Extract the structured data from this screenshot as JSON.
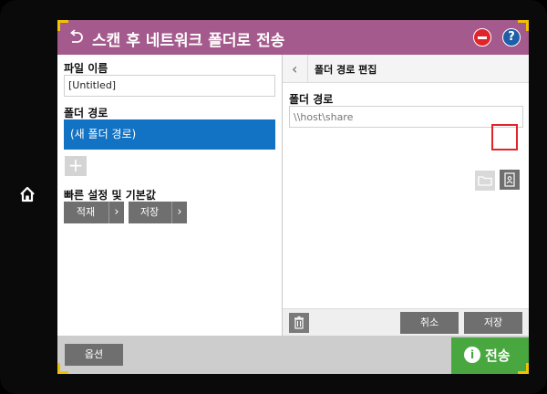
{
  "header": {
    "title": "스캔 후 네트워크 폴더로 전송",
    "help_label": "?"
  },
  "left": {
    "file_name_label": "파일 이름",
    "file_name_value": "[Untitled]",
    "folder_path_label": "폴더 경로",
    "selected_path": "(새 폴더 경로)",
    "add_label": "+",
    "quick_sets_label": "빠른 설정 및 기본값",
    "load_label": "적재",
    "save_label": "저장"
  },
  "right": {
    "title": "폴더 경로 편집",
    "folder_path_label": "폴더 경로",
    "folder_path_placeholder": "\\\\host\\share",
    "cancel_label": "취소",
    "save_label": "저장"
  },
  "footer": {
    "options_label": "옵션",
    "send_label": "전송"
  },
  "colors": {
    "header_bg": "#a45a8c",
    "selection": "#1272c4",
    "send_green": "#48a83f",
    "stop_red": "#e0242a",
    "help_blue": "#1e5fa8",
    "corner_yellow": "#f2c200"
  },
  "icons": [
    "home-icon",
    "back-arrow-icon",
    "stop-icon",
    "help-icon",
    "chevron-left-icon",
    "chevron-right-icon",
    "folder-icon",
    "contacts-icon",
    "trash-icon",
    "info-icon"
  ]
}
